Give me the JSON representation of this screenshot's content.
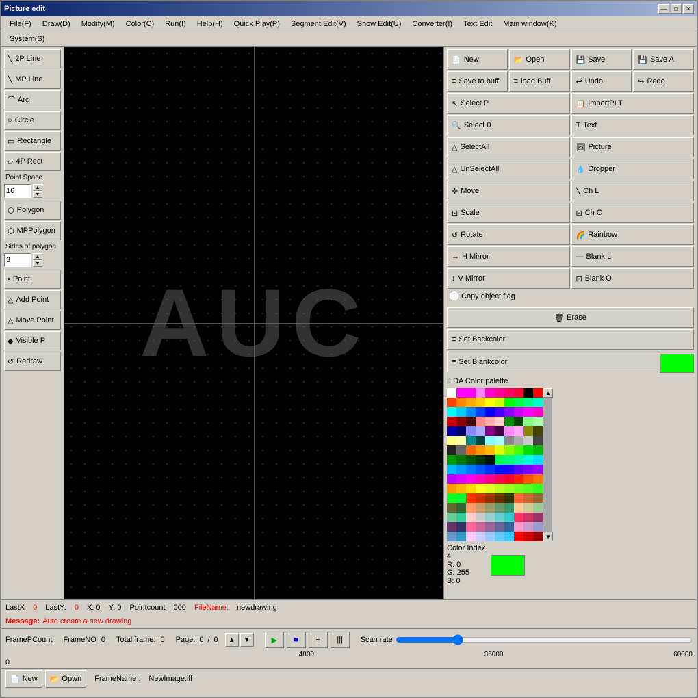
{
  "window": {
    "title": "Picture edit",
    "min_btn": "—",
    "max_btn": "□",
    "close_btn": "✕"
  },
  "menubar": {
    "items": [
      "File(F)",
      "Draw(D)",
      "Modify(M)",
      "Color(C)",
      "Run(I)",
      "Help(H)",
      "Quick Play(P)",
      "Segment Edit(V)",
      "Show Edit(U)",
      "Converter(I)",
      "Text Edit",
      "Main window(K)"
    ]
  },
  "menubar2": {
    "items": [
      "System(S)"
    ]
  },
  "left_tools": {
    "tools": [
      {
        "label": "2P Line",
        "icon": "/"
      },
      {
        "label": "MP Line",
        "icon": "/"
      },
      {
        "label": "Arc",
        "icon": "⌒"
      },
      {
        "label": "Circle",
        "icon": "○"
      },
      {
        "label": "Rectangle",
        "icon": "□"
      },
      {
        "label": "4P Rect",
        "icon": "□"
      },
      {
        "label": "Polygon",
        "icon": "⬡"
      },
      {
        "label": "MPPolygon",
        "icon": "⬡"
      },
      {
        "label": "Point",
        "icon": "•"
      },
      {
        "label": "Add Point",
        "icon": "△"
      },
      {
        "label": "Move Point",
        "icon": "△"
      },
      {
        "label": "Visible P",
        "icon": "◆"
      },
      {
        "label": "Redraw",
        "icon": "↺"
      }
    ],
    "point_space_label": "Point Space",
    "point_space_value": "16",
    "sides_label": "Sides of polygon",
    "sides_value": "3"
  },
  "canvas": {
    "text": "AUC",
    "background": "#000000"
  },
  "right_toolbar": {
    "row1": [
      {
        "label": "New",
        "icon": "📄"
      },
      {
        "label": "Open",
        "icon": "📂"
      },
      {
        "label": "Save",
        "icon": "💾"
      },
      {
        "label": "Save A",
        "icon": "💾"
      }
    ],
    "row2": [
      {
        "label": "Save to buff",
        "icon": "≡"
      },
      {
        "label": "load Buff",
        "icon": "≡"
      },
      {
        "label": "Undo",
        "icon": "↩"
      },
      {
        "label": "Redo",
        "icon": "↪"
      }
    ],
    "row3": [
      {
        "label": "Select P",
        "icon": "↖"
      },
      {
        "label": "ImportPLT",
        "icon": "📋"
      }
    ],
    "row4": [
      {
        "label": "Select 0",
        "icon": "🔍"
      },
      {
        "label": "Text",
        "icon": "T"
      }
    ],
    "row5": [
      {
        "label": "SelectAll",
        "icon": "△"
      },
      {
        "label": "Picture",
        "icon": "🖼"
      }
    ],
    "row6": [
      {
        "label": "UnSelectAll",
        "icon": "△"
      },
      {
        "label": "Dropper",
        "icon": "💧"
      }
    ],
    "row7": [
      {
        "label": "Move",
        "icon": "+"
      },
      {
        "label": "Ch L",
        "icon": "\\"
      }
    ],
    "row8": [
      {
        "label": "Scale",
        "icon": "⊡"
      },
      {
        "label": "Ch O",
        "icon": "⊡"
      }
    ],
    "row9": [
      {
        "label": "Rotate",
        "icon": "↺"
      },
      {
        "label": "Rainbow",
        "icon": "🌈"
      }
    ],
    "row10": [
      {
        "label": "H Mirror",
        "icon": "↔"
      },
      {
        "label": "Blank L",
        "icon": "—"
      }
    ],
    "row11": [
      {
        "label": "V Mirror",
        "icon": "↕"
      },
      {
        "label": "Blank O",
        "icon": "⊡"
      }
    ]
  },
  "palette": {
    "title": "ILDA Color palette",
    "colors": [
      "#ffffff",
      "#ff00ff",
      "#ff00ff",
      "#ff80ff",
      "#ff00cc",
      "#ff0099",
      "#ff0066",
      "#ff0033",
      "#000000",
      "#ff0000",
      "#ff4400",
      "#ff8800",
      "#ffaa00",
      "#ffcc00",
      "#ffff00",
      "#ccff00",
      "#00ff00",
      "#00ff44",
      "#00ff88",
      "#00ffcc",
      "#00ffff",
      "#00ccff",
      "#0088ff",
      "#0044ff",
      "#0000ff",
      "#4400ff",
      "#8800ff",
      "#cc00ff",
      "#ff00ff",
      "#ff00cc",
      "#cc0000",
      "#880000",
      "#440000",
      "#ff8888",
      "#ffaaaa",
      "#ffcccc",
      "#008800",
      "#004400",
      "#88ff88",
      "#aaffaa",
      "#0000aa",
      "#000066",
      "#8888ff",
      "#aaaaff",
      "#880088",
      "#440044",
      "#ff88ff",
      "#ffaaff",
      "#888800",
      "#444400",
      "#ffff88",
      "#ffffaa",
      "#008888",
      "#004444",
      "#88ffff",
      "#aaffff",
      "#888888",
      "#aaaaaa",
      "#cccccc",
      "#444444",
      "#222222",
      "#666666",
      "#ff6600",
      "#ff9900",
      "#ffbb00",
      "#ddff00",
      "#88ff00",
      "#44ff00",
      "#00dd00",
      "#00bb00",
      "#009900",
      "#007700",
      "#005500",
      "#003300",
      "#001100",
      "#00ff55",
      "#00ff77",
      "#00ffaa",
      "#00ffdd",
      "#00ddff",
      "#00bbff",
      "#0099ff",
      "#0077ff",
      "#0055ff",
      "#0033ff",
      "#0011ff",
      "#2200ff",
      "#5500ff",
      "#7700ff",
      "#9900ff",
      "#bb00ff",
      "#dd00ff",
      "#ff00ee",
      "#ff00bb",
      "#ff0088",
      "#ff0055",
      "#ff0022",
      "#ff2200",
      "#ff5500",
      "#ff7700",
      "#ff9900",
      "#ffbb00",
      "#ffdd00",
      "#ffff22",
      "#ddff22",
      "#bbff22",
      "#99ff22",
      "#77ff22",
      "#55ff22",
      "#33ff22",
      "#11ff22",
      "#00ff33",
      "#ff3300",
      "#cc3300",
      "#993300",
      "#663300",
      "#333300",
      "#ff6633",
      "#cc6633",
      "#996633",
      "#666633",
      "#336633",
      "#ff9966",
      "#cc9966",
      "#999966",
      "#669966",
      "#339966",
      "#ffcc99",
      "#cccc99",
      "#99cc99",
      "#66cc99",
      "#33cc99",
      "#ffcccc",
      "#cccccc",
      "#99cccc",
      "#66cccc",
      "#33cccc",
      "#ff3366",
      "#cc3366",
      "#993366",
      "#663366",
      "#333366",
      "#ff6699",
      "#cc6699",
      "#996699",
      "#666699",
      "#336699",
      "#ff99cc",
      "#cc99cc",
      "#9999cc",
      "#6699cc",
      "#3399cc",
      "#ffccff",
      "#ccccff",
      "#99ccff",
      "#66ccff",
      "#33ccff",
      "#ff0000",
      "#cc0000",
      "#990000"
    ]
  },
  "color_index": {
    "label": "Color Index",
    "index": "4",
    "r_label": "R:",
    "r_value": "0",
    "g_label": "G:",
    "g_value": "255",
    "b_label": "B:",
    "b_value": "0",
    "swatch_color": "#00ff00"
  },
  "action_buttons": {
    "erase_label": "Erase",
    "set_backcolor_label": "Set Backcolor",
    "set_blankcolor_label": "Set Blankcolor",
    "copy_flag_label": "Copy object flag"
  },
  "status": {
    "lastx_label": "LastX",
    "lastx_value": "0",
    "lasty_label": "LastY:",
    "lasty_value": "0",
    "x_label": "X: 0",
    "y_label": "Y: 0",
    "pointcount_label": "Pointcount",
    "pointcount_value": "000",
    "filename_label": "FileName:",
    "filename_value": "newdrawing"
  },
  "message": {
    "label": "Message:",
    "text": "Auto create a new drawing"
  },
  "bottom": {
    "frame_pcount_label": "FramePCount",
    "frame_pcount_value": "0",
    "frame_no_label": "FrameNO",
    "frame_no_value": "0",
    "total_frame_label": "Total frame:",
    "total_frame_value": "0",
    "page_label": "Page:",
    "page_value": "0",
    "page_sep": "/",
    "page_total": "0",
    "scan_rate_label": "Scan rate",
    "scan_values": [
      "4800",
      "36000",
      "60000"
    ],
    "framename_label": "FrameName :",
    "framename_value": "NewImage.ilf",
    "new_btn": "New",
    "opwn_btn": "Opwn"
  }
}
